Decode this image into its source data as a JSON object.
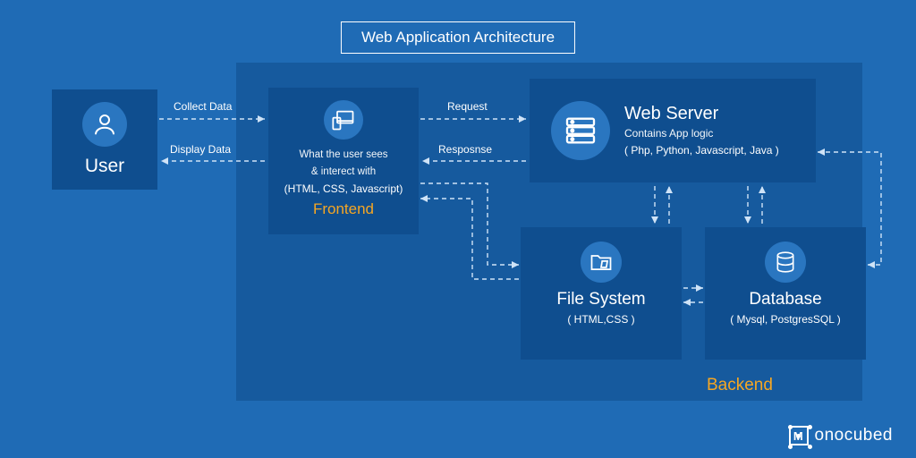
{
  "title": "Web  Application Architecture",
  "nodes": {
    "user": {
      "title": "User"
    },
    "frontend": {
      "desc1": "What the user sees",
      "desc2": "& interect with",
      "techs": "(HTML, CSS, Javascript)",
      "section": "Frontend"
    },
    "webserver": {
      "title": "Web Server",
      "sub": "Contains App logic",
      "techs": "( Php, Python, Javascript, Java )"
    },
    "filesystem": {
      "title": "File System",
      "techs": "( HTML,CSS )"
    },
    "database": {
      "title": "Database",
      "techs": "( Mysql, PostgresSQL )"
    }
  },
  "labels": {
    "collect": "Collect Data",
    "display": "Display Data",
    "request": "Request",
    "response": "Resposnse",
    "backend": "Backend"
  },
  "brand": {
    "letter": "M",
    "rest": "onocubed"
  }
}
